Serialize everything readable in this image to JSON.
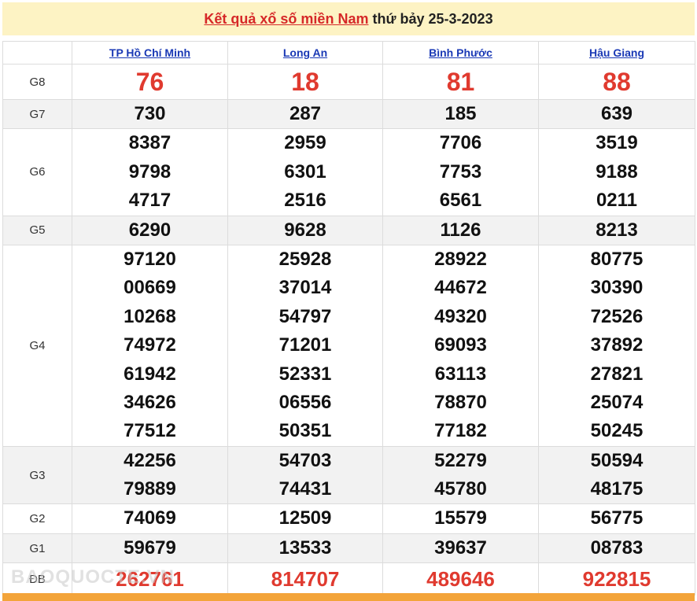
{
  "header": {
    "title_link": "Kết quả xổ số miền Nam",
    "title_rest": "thứ bảy 25-3-2023"
  },
  "provinces": [
    "TP Hồ Chí Minh",
    "Long An",
    "Bình Phước",
    "Hậu Giang"
  ],
  "prizes": [
    {
      "label": "G8",
      "style": "big-red",
      "rows": [
        [
          "76",
          "18",
          "81",
          "88"
        ]
      ]
    },
    {
      "label": "G7",
      "style": "num",
      "rows": [
        [
          "730",
          "287",
          "185",
          "639"
        ]
      ]
    },
    {
      "label": "G6",
      "style": "num",
      "rows": [
        [
          "8387",
          "2959",
          "7706",
          "3519"
        ],
        [
          "9798",
          "6301",
          "7753",
          "9188"
        ],
        [
          "4717",
          "2516",
          "6561",
          "0211"
        ]
      ]
    },
    {
      "label": "G5",
      "style": "num",
      "rows": [
        [
          "6290",
          "9628",
          "1126",
          "8213"
        ]
      ]
    },
    {
      "label": "G4",
      "style": "num",
      "rows": [
        [
          "97120",
          "25928",
          "28922",
          "80775"
        ],
        [
          "00669",
          "37014",
          "44672",
          "30390"
        ],
        [
          "10268",
          "54797",
          "49320",
          "72526"
        ],
        [
          "74972",
          "71201",
          "69093",
          "37892"
        ],
        [
          "61942",
          "52331",
          "63113",
          "27821"
        ],
        [
          "34626",
          "06556",
          "78870",
          "25074"
        ],
        [
          "77512",
          "50351",
          "77182",
          "50245"
        ]
      ]
    },
    {
      "label": "G3",
      "style": "num",
      "rows": [
        [
          "42256",
          "54703",
          "52279",
          "50594"
        ],
        [
          "79889",
          "74431",
          "45780",
          "48175"
        ]
      ]
    },
    {
      "label": "G2",
      "style": "num",
      "rows": [
        [
          "74069",
          "12509",
          "15579",
          "56775"
        ]
      ]
    },
    {
      "label": "G1",
      "style": "num",
      "rows": [
        [
          "59679",
          "13533",
          "39637",
          "08783"
        ]
      ]
    },
    {
      "label": "ĐB",
      "style": "red-db",
      "rows": [
        [
          "262761",
          "814707",
          "489646",
          "922815"
        ]
      ]
    }
  ],
  "watermark": "BAOQUOCTE.VN",
  "colors": {
    "accent_red": "#e03a2f",
    "link_blue": "#1a39b5",
    "title_bg": "#fdf3c4",
    "bottom_bar": "#f3a43a"
  }
}
